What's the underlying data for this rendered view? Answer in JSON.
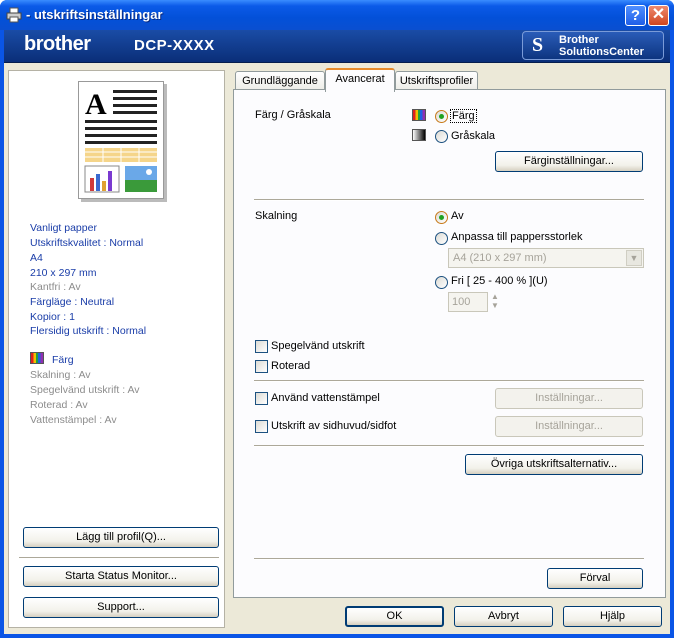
{
  "window": {
    "title": "- utskriftsinställningar"
  },
  "banner": {
    "brand": "brother",
    "model": "DCP-XXXX",
    "solutions_line1": "Brother",
    "solutions_line2": "SolutionsCenter"
  },
  "summary": {
    "lines_blue": [
      "Vanligt papper",
      "Utskriftskvalitet : Normal",
      "A4",
      "210 x 297 mm"
    ],
    "lines_grey1": [
      "Kantfri : Av"
    ],
    "lines_blue2": [
      "Färgläge : Neutral",
      "Kopior : 1",
      "Flersidig utskrift : Normal"
    ],
    "color_label": "Färg",
    "lines_grey2": [
      "Skalning : Av",
      "Spegelvänd utskrift : Av",
      "Roterad : Av",
      "Vattenstämpel : Av"
    ]
  },
  "left_buttons": {
    "add_profile": "Lägg till profil(Q)...",
    "status_monitor": "Starta Status Monitor...",
    "support": "Support..."
  },
  "tabs": [
    "Grundläggande",
    "Avancerat",
    "Utskriftsprofiler"
  ],
  "active_tab": "Avancerat",
  "color_section": {
    "label": "Färg / Gråskala",
    "option_color": "Färg",
    "option_gray": "Gråskala",
    "selected": "Färg",
    "settings_button": "Färginställningar..."
  },
  "scaling_section": {
    "label": "Skalning",
    "option_off": "Av",
    "option_fit": "Anpassa till pappersstorlek",
    "paper_size": "A4 (210 x 297 mm)",
    "option_free": "Fri [ 25 - 400 % ](U)",
    "free_value": "100",
    "selected": "Av"
  },
  "checkboxes": {
    "mirror": "Spegelvänd utskrift",
    "rotated": "Roterad",
    "watermark": "Använd vattenstämpel",
    "header_footer": "Utskrift av sidhuvud/sidfot"
  },
  "settings_buttons": {
    "watermark_settings": "Inställningar...",
    "header_settings": "Inställningar..."
  },
  "other_options_button": "Övriga utskriftsalternativ...",
  "default_button": "Förval",
  "bottom_buttons": {
    "ok": "OK",
    "cancel": "Avbryt",
    "help": "Hjälp"
  }
}
